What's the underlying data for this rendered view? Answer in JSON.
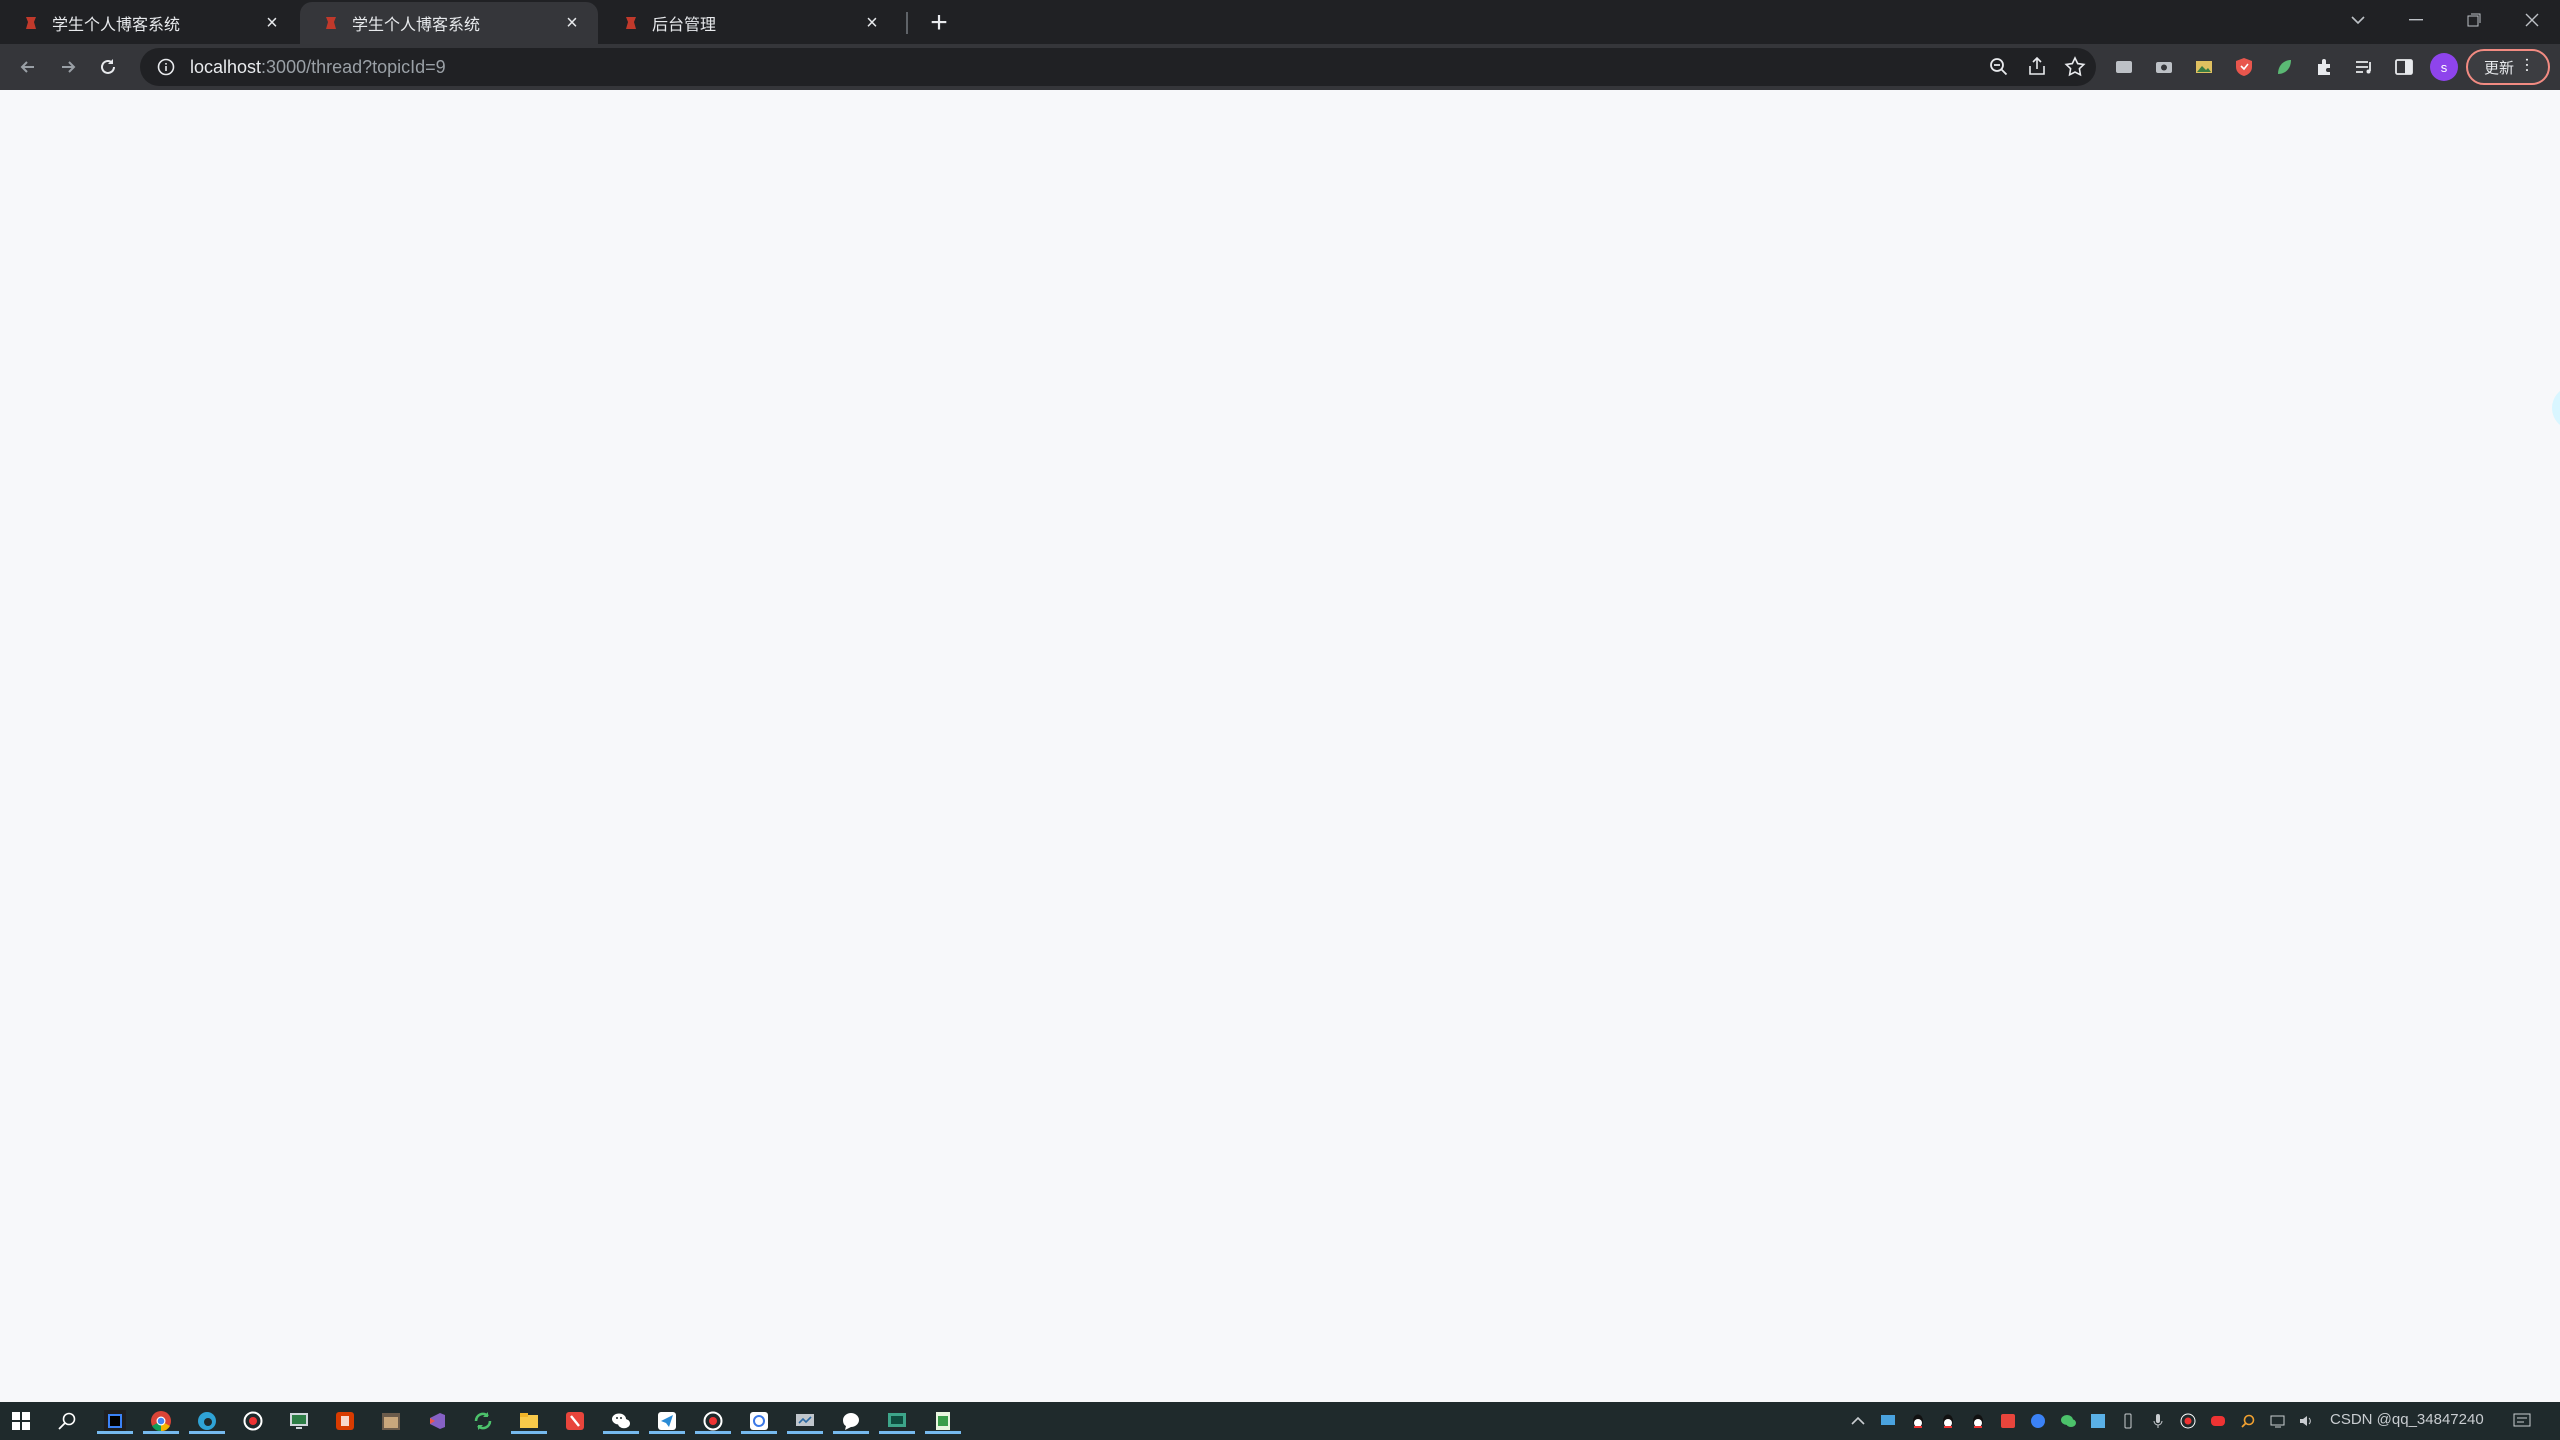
{
  "browser": {
    "tabs": [
      {
        "title": "学生个人博客系统",
        "active": false
      },
      {
        "title": "学生个人博客系统",
        "active": true
      },
      {
        "title": "后台管理",
        "active": false
      }
    ],
    "address": {
      "host": "localhost",
      "path": ":3000/thread?topicId=9"
    },
    "profile_initial": "s",
    "update_label": "更新"
  },
  "taskbar": {
    "watermark": "CSDN @qq_34847240"
  },
  "colors": {
    "tabstrip": "#202124",
    "toolbar": "#35363a",
    "page_bg": "#f7f8fa",
    "taskbar": "#1f2a2c"
  }
}
